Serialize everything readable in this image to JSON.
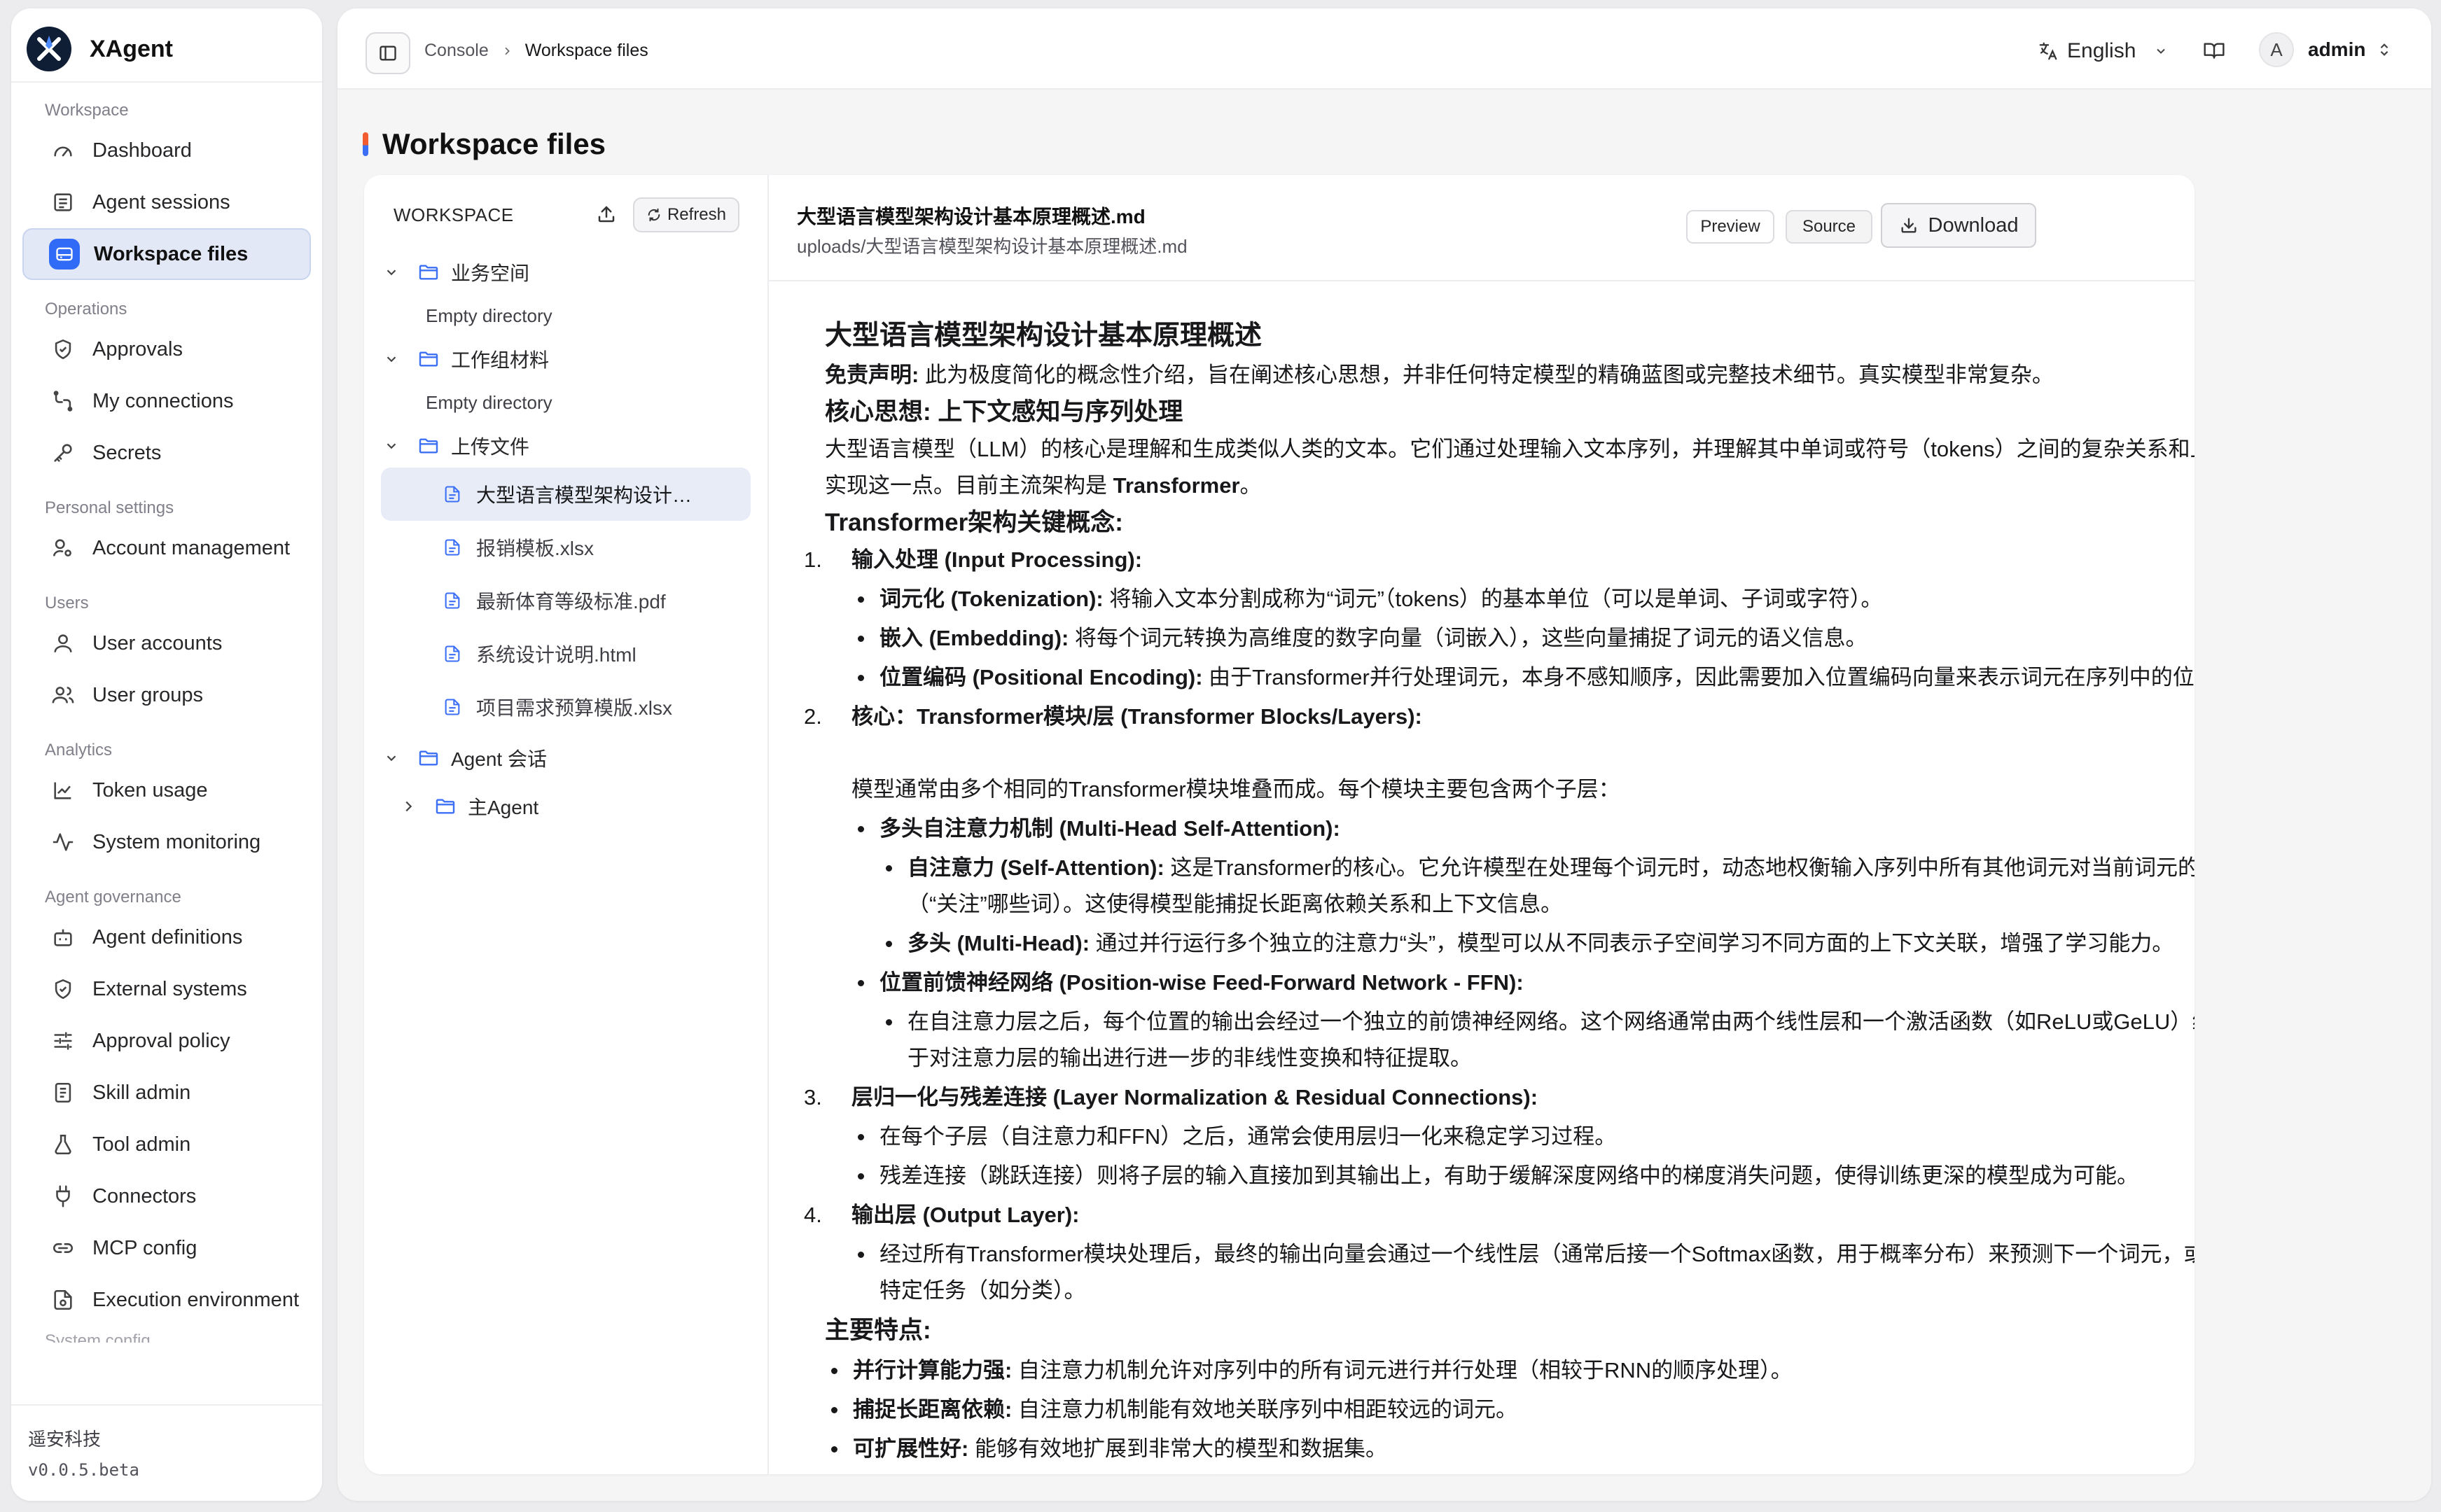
{
  "app": {
    "name": "XAgent",
    "company": "遥安科技",
    "version": "v0.0.5.beta"
  },
  "sidebar": {
    "sections": [
      {
        "label": "Workspace",
        "items": [
          "Dashboard",
          "Agent sessions",
          "Workspace files"
        ]
      },
      {
        "label": "Operations",
        "items": [
          "Approvals",
          "My connections",
          "Secrets"
        ]
      },
      {
        "label": "Personal settings",
        "items": [
          "Account management"
        ]
      },
      {
        "label": "Users",
        "items": [
          "User accounts",
          "User groups"
        ]
      },
      {
        "label": "Analytics",
        "items": [
          "Token usage",
          "System monitoring"
        ]
      },
      {
        "label": "Agent governance",
        "items": [
          "Agent definitions",
          "External systems",
          "Approval policy",
          "Skill admin",
          "Tool admin",
          "Connectors",
          "MCP config",
          "Execution environment"
        ]
      }
    ],
    "active_item": "Workspace files",
    "partial_section": "System config"
  },
  "topbar": {
    "breadcrumb": {
      "root": "Console",
      "current": "Workspace files"
    },
    "language": "English",
    "user": {
      "initial": "A",
      "name": "admin"
    }
  },
  "page": {
    "title": "Workspace files"
  },
  "tree": {
    "heading": "WORKSPACE",
    "refresh_label": "Refresh",
    "empty_label": "Empty directory",
    "folders": [
      "业务空间",
      "工作组材料",
      "上传文件",
      "Agent 会话",
      "主Agent"
    ],
    "files": [
      "大型语言模型架构设计基本原理概述.md",
      "报销模板.xlsx",
      "最新体育等级标准.pdf",
      "系统设计说明.html",
      "项目需求预算模版.xlsx"
    ]
  },
  "viewer": {
    "file_name": "大型语言模型架构设计基本原理概述.md",
    "file_path": "uploads/大型语言模型架构设计基本原理概述.md",
    "preview_label": "Preview",
    "source_label": "Source",
    "download_label": "Download"
  },
  "doc": {
    "title": "大型语言模型架构设计基本原理概述",
    "disclaimer_label": "免责声明:",
    "disclaimer_text": " 此为极度简化的概念性介绍，旨在阐述核心思想，并非任何特定模型的精确蓝图或完整技术细节。真实模型非常复杂。",
    "h_core": "核心思想: 上下文感知与序列处理",
    "core_text": "大型语言模型（LLM）的核心是理解和生成类似人类的文本。它们通过处理输入文本序列，并理解其中单词或符号（tokens）之间的复杂关系和上下文来实现这一点。目前主流架构是 ",
    "core_bold": "Transformer",
    "core_end": "。",
    "h_concepts": "Transformer架构关键概念:",
    "s1": {
      "num": "1.",
      "title": "输入处理 (Input Processing):",
      "items": [
        {
          "b": "词元化 (Tokenization):",
          "t": " 将输入文本分割成称为“词元”（tokens）的基本单位（可以是单词、子词或字符）。"
        },
        {
          "b": "嵌入 (Embedding):",
          "t": " 将每个词元转换为高维度的数字向量（词嵌入），这些向量捕捉了词元的语义信息。"
        },
        {
          "b": "位置编码 (Positional Encoding):",
          "t": " 由于Transformer并行处理词元，本身不感知顺序，因此需要加入位置编码向量来表示词元在序列中的位置信息。"
        }
      ]
    },
    "s2": {
      "num": "2.",
      "title": "核心：Transformer模块/层 (Transformer Blocks/Layers):",
      "intro": "模型通常由多个相同的Transformer模块堆叠而成。每个模块主要包含两个子层：",
      "mha": "多头自注意力机制 (Multi-Head Self-Attention):",
      "sa_b": "自注意力 (Self-Attention):",
      "sa_t": " 这是Transformer的核心。它允许模型在处理每个词元时，动态地权衡输入序列中所有其他词元对当前词元的重要性（“关注”哪些词）。这使得模型能捕捉长距离依赖关系和上下文信息。",
      "mh_b": "多头 (Multi-Head):",
      "mh_t": " 通过并行运行多个独立的注意力“头”，模型可以从不同表示子空间学习不同方面的上下文关联，增强了学习能力。",
      "ffn": "位置前馈神经网络 (Position-wise Feed-Forward Network - FFN):",
      "ffn_t": "在自注意力层之后，每个位置的输出会经过一个独立的前馈神经网络。这个网络通常由两个线性层和一个激活函数（如ReLU或GeLU）组成，用于对注意力层的输出进行进一步的非线性变换和特征提取。"
    },
    "s3": {
      "num": "3.",
      "title": "层归一化与残差连接 (Layer Normalization & Residual Connections):",
      "items": [
        "在每个子层（自注意力和FFN）之后，通常会使用层归一化来稳定学习过程。",
        "残差连接（跳跃连接）则将子层的输入直接加到其输出上，有助于缓解深度网络中的梯度消失问题，使得训练更深的模型成为可能。"
      ]
    },
    "s4": {
      "num": "4.",
      "title": "输出层 (Output Layer):",
      "items": [
        "经过所有Transformer模块处理后，最终的输出向量会通过一个线性层（通常后接一个Softmax函数，用于概率分布）来预测下一个词元，或用于其他特定任务（如分类）。"
      ]
    },
    "h_features": "主要特点:",
    "features": [
      {
        "b": "并行计算能力强:",
        "t": " 自注意力机制允许对序列中的所有词元进行并行处理（相较于RNN的顺序处理）。"
      },
      {
        "b": "捕捉长距离依赖:",
        "t": " 自注意力机制能有效地关联序列中相距较远的词元。"
      },
      {
        "b": "可扩展性好:",
        "t": " 能够有效地扩展到非常大的模型和数据集。"
      }
    ]
  }
}
